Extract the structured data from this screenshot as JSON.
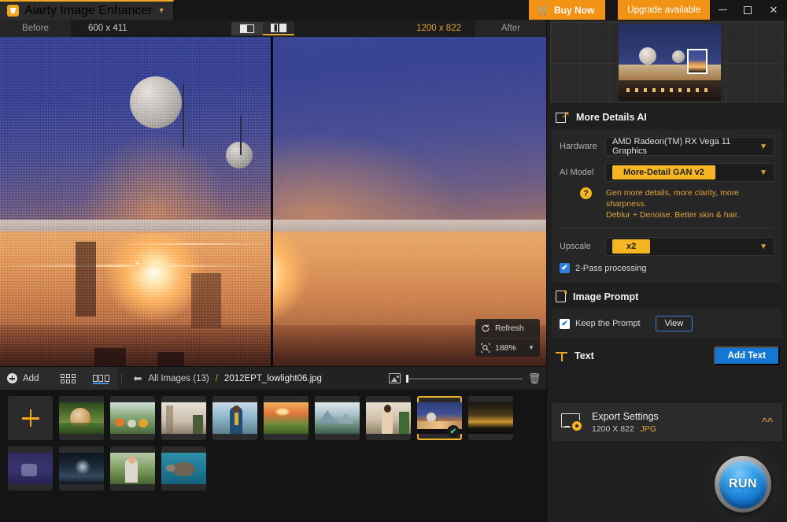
{
  "titlebar": {
    "app_name": "Aiarty Image Enhancer",
    "dropdown_icon": "chevron-down-icon",
    "logo_icon": "aiarty-logo-icon",
    "buy_now": "Buy Now",
    "cart_icon": "cart-icon",
    "upgrade": "Upgrade available",
    "minimize": "minimize-icon",
    "maximize": "maximize-icon",
    "close": "close-icon"
  },
  "viewer": {
    "before_label": "Before",
    "before_size": "600 x 411",
    "after_label": "After",
    "after_size": "1200 x 822",
    "split_single_icon": "split-single-view-icon",
    "split_dual_icon": "split-dual-view-icon",
    "refresh_label": "Refresh",
    "refresh_icon": "refresh-icon",
    "zoom_value": "188%",
    "zoom_icon": "zoom-icon",
    "zoom_caret": "chevron-down-icon"
  },
  "bottombar": {
    "add_label": "Add",
    "add_icon": "plus-circle-icon",
    "grid_view_icon": "grid-view-icon",
    "filmstrip_view_icon": "filmstrip-view-icon",
    "back_icon": "back-arrow-icon",
    "breadcrumb_all": "All Images (13)",
    "breadcrumb_sep": "/",
    "breadcrumb_file": "2012EPT_lowlight06.jpg",
    "thumb_size_icon": "image-size-icon",
    "trash_icon": "trash-icon"
  },
  "filmstrip": {
    "add_tile_icon": "plus-icon",
    "selected_index": 8,
    "check_icon": "check-icon",
    "thumbs": [
      {
        "name": "tiger-in-jungle"
      },
      {
        "name": "vegetables-still-life"
      },
      {
        "name": "interior-room"
      },
      {
        "name": "woman-by-the-sea"
      },
      {
        "name": "sunset-hills"
      },
      {
        "name": "mountain-lake"
      },
      {
        "name": "woman-portrait-column"
      },
      {
        "name": "night-observatory",
        "selected": true
      },
      {
        "name": "city-night-skyline"
      },
      {
        "name": "purple-night-scene"
      },
      {
        "name": "dark-cave-water"
      },
      {
        "name": "child-outdoors"
      },
      {
        "name": "sea-turtle"
      }
    ]
  },
  "panel": {
    "navigator_icon": "navigator-preview",
    "more_details": {
      "title": "More Details AI",
      "icon": "more-details-ai-icon",
      "hardware_label": "Hardware",
      "hardware_value": "AMD Radeon(TM) RX Vega 11 Graphics",
      "model_label": "AI Model",
      "model_value": "More-Detail GAN v2",
      "help_icon": "question-mark-icon",
      "hint_line1": "Gen more details, more clarity, more sharpness.",
      "hint_line2": "Deblur + Denoise. Better skin & hair.",
      "upscale_label": "Upscale",
      "upscale_value": "x2",
      "two_pass_label": "2-Pass processing",
      "two_pass_checked": true,
      "caret_icon": "chevron-down-icon"
    },
    "image_prompt": {
      "title": "Image Prompt",
      "icon": "document-icon",
      "keep_prompt_label": "Keep the Prompt",
      "keep_prompt_checked": true,
      "view_button": "View"
    },
    "text_section": {
      "title": "Text",
      "icon": "text-tool-icon",
      "add_text_button": "Add Text"
    },
    "export": {
      "icon": "export-settings-icon",
      "title": "Export Settings",
      "dimensions": "1200 X 822",
      "format": "JPG",
      "collapse_icon": "chevron-up-icon"
    },
    "run_button": "RUN"
  },
  "colors": {
    "accent_orange": "#f0a81e",
    "accent_blue": "#1477d4",
    "panel_bg": "#1f1f1f",
    "card_bg": "#262626",
    "check_green": "#3fd17a"
  }
}
